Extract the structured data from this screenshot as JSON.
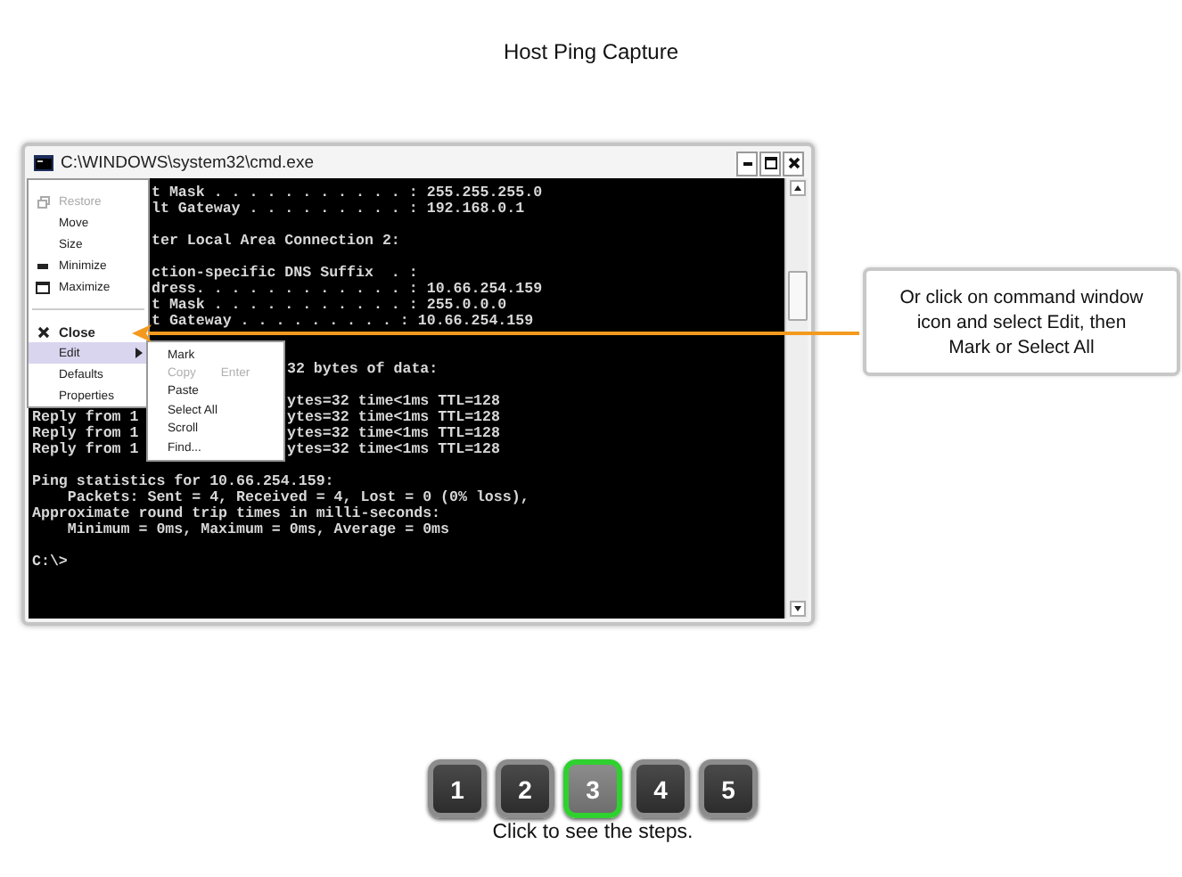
{
  "page_title": "Host Ping Capture",
  "window": {
    "title": "C:\\WINDOWS\\system32\\cmd.exe",
    "console_lines": [
      {
        "kind": "text",
        "segments": [
          {
            "kind": "after-menu",
            "text": "t Mask . . . . . . . . . . . : 255.255.255.0"
          }
        ]
      },
      {
        "kind": "text",
        "segments": [
          {
            "kind": "after-menu",
            "text": "lt Gateway . . . . . . . . . : 192.168.0.1"
          }
        ]
      },
      {
        "kind": "blank"
      },
      {
        "kind": "text",
        "segments": [
          {
            "kind": "after-menu",
            "text": "ter Local Area Connection 2:"
          }
        ]
      },
      {
        "kind": "blank"
      },
      {
        "kind": "text",
        "segments": [
          {
            "kind": "after-menu",
            "text": "ction-specific DNS Suffix  . :"
          }
        ]
      },
      {
        "kind": "text",
        "segments": [
          {
            "kind": "after-menu",
            "text": "dress. . . . . . . . . . . . : 10.66.254.159"
          }
        ]
      },
      {
        "kind": "text",
        "segments": [
          {
            "kind": "after-menu",
            "text": "t Mask . . . . . . . . . . . : 255.0.0.0"
          }
        ]
      },
      {
        "kind": "text",
        "segments": [
          {
            "kind": "after-menu",
            "text": "t Gateway . . . . . . . . . : 10.66.254.159"
          }
        ]
      },
      {
        "kind": "blank"
      },
      {
        "kind": "blank"
      },
      {
        "kind": "text",
        "segments": [
          {
            "kind": "after-submenu",
            "text": "32 bytes of data:"
          }
        ]
      },
      {
        "kind": "blank"
      },
      {
        "kind": "text",
        "segments": [
          {
            "kind": "after-submenu",
            "text": "ytes=32 time<1ms TTL=128"
          }
        ]
      },
      {
        "kind": "text",
        "segments": [
          {
            "kind": "start",
            "text": "Reply from 1"
          },
          {
            "kind": "after-submenu",
            "text": "ytes=32 time<1ms TTL=128"
          }
        ]
      },
      {
        "kind": "text",
        "segments": [
          {
            "kind": "start",
            "text": "Reply from 1"
          },
          {
            "kind": "after-submenu",
            "text": "ytes=32 time<1ms TTL=128"
          }
        ]
      },
      {
        "kind": "text",
        "segments": [
          {
            "kind": "start",
            "text": "Reply from 1"
          },
          {
            "kind": "after-submenu",
            "text": "ytes=32 time<1ms TTL=128"
          }
        ]
      },
      {
        "kind": "blank"
      },
      {
        "kind": "text",
        "segments": [
          {
            "kind": "start",
            "text": "Ping statistics for 10.66.254.159:"
          }
        ]
      },
      {
        "kind": "text",
        "segments": [
          {
            "kind": "start",
            "text": "    Packets: Sent = 4, Received = 4, Lost = 0 (0% loss),"
          }
        ]
      },
      {
        "kind": "text",
        "segments": [
          {
            "kind": "start",
            "text": "Approximate round trip times in milli-seconds:"
          }
        ]
      },
      {
        "kind": "text",
        "segments": [
          {
            "kind": "start",
            "text": "    Minimum = 0ms, Maximum = 0ms, Average = 0ms"
          }
        ]
      },
      {
        "kind": "blank"
      },
      {
        "kind": "text",
        "segments": [
          {
            "kind": "start",
            "text": "C:\\>"
          }
        ]
      }
    ],
    "system_menu": [
      {
        "kind": "restore",
        "label": "Restore",
        "disabled": true,
        "selected": false,
        "has_submenu": false
      },
      {
        "kind": "move",
        "label": "Move",
        "disabled": false,
        "selected": false,
        "has_submenu": false
      },
      {
        "kind": "size",
        "label": "Size",
        "disabled": false,
        "selected": false,
        "has_submenu": false
      },
      {
        "kind": "minimize",
        "label": "Minimize",
        "disabled": false,
        "selected": false,
        "has_submenu": false
      },
      {
        "kind": "maximize",
        "label": "Maximize",
        "disabled": false,
        "selected": false,
        "has_submenu": false
      },
      {
        "kind": "separator"
      },
      {
        "kind": "close",
        "label": "Close",
        "disabled": false,
        "selected": false,
        "has_submenu": false
      },
      {
        "kind": "edit",
        "label": "Edit",
        "disabled": false,
        "selected": true,
        "has_submenu": true
      },
      {
        "kind": "defaults",
        "label": "Defaults",
        "disabled": false,
        "selected": false,
        "has_submenu": false
      },
      {
        "kind": "properties",
        "label": "Properties",
        "disabled": false,
        "selected": false,
        "has_submenu": false
      }
    ],
    "edit_submenu": [
      {
        "label": "Mark",
        "disabled": false
      },
      {
        "label": "Copy",
        "disabled": true,
        "shortcut": "Enter"
      },
      {
        "label": "Paste",
        "disabled": false
      },
      {
        "label": "Select All",
        "disabled": false
      },
      {
        "label": "Scroll",
        "disabled": false
      },
      {
        "label": "Find...",
        "disabled": false
      }
    ]
  },
  "callout": {
    "text": "Or click on command window icon and select Edit, then Mark or Select All"
  },
  "steps": [
    {
      "label": "1",
      "selected": false
    },
    {
      "label": "2",
      "selected": false
    },
    {
      "label": "3",
      "selected": true
    },
    {
      "label": "4",
      "selected": false
    },
    {
      "label": "5",
      "selected": false
    }
  ],
  "steps_hint": "Click to see the steps."
}
